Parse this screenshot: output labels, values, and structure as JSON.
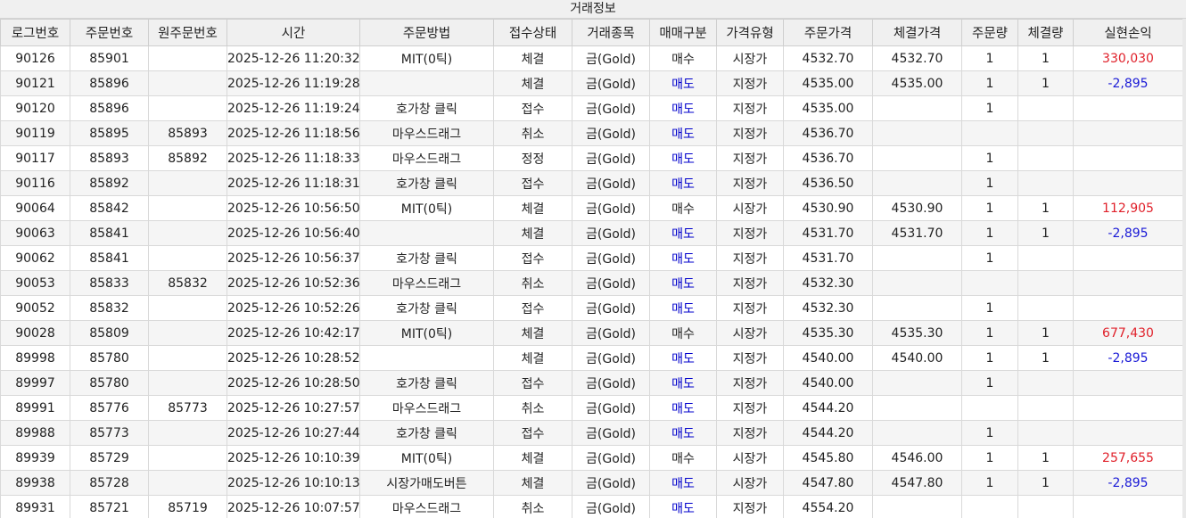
{
  "window": {
    "title": "거래정보"
  },
  "columns": [
    "로그번호",
    "주문번호",
    "원주문번호",
    "시간",
    "주문방법",
    "접수상태",
    "거래종목",
    "매매구분",
    "가격유형",
    "주문가격",
    "체결가격",
    "주문량",
    "체결량",
    "실현손익"
  ],
  "colors": {
    "sell": "#0000cc",
    "pnl_positive": "#e0202a",
    "pnl_negative": "#1a1ad6"
  },
  "rows": [
    {
      "log": "90126",
      "order": "85901",
      "orig": "",
      "time": "2025-12-26 11:20:32",
      "method": "MIT(0틱)",
      "status": "체결",
      "item": "금(Gold)",
      "side": "매수",
      "ptype": "시장가",
      "oprice": "4532.70",
      "fprice": "4532.70",
      "oqty": "1",
      "fqty": "1",
      "pnl": "330,030"
    },
    {
      "log": "90121",
      "order": "85896",
      "orig": "",
      "time": "2025-12-26 11:19:28",
      "method": "",
      "status": "체결",
      "item": "금(Gold)",
      "side": "매도",
      "ptype": "지정가",
      "oprice": "4535.00",
      "fprice": "4535.00",
      "oqty": "1",
      "fqty": "1",
      "pnl": "-2,895"
    },
    {
      "log": "90120",
      "order": "85896",
      "orig": "",
      "time": "2025-12-26 11:19:24",
      "method": "호가창 클릭",
      "status": "접수",
      "item": "금(Gold)",
      "side": "매도",
      "ptype": "지정가",
      "oprice": "4535.00",
      "fprice": "",
      "oqty": "1",
      "fqty": "",
      "pnl": ""
    },
    {
      "log": "90119",
      "order": "85895",
      "orig": "85893",
      "time": "2025-12-26 11:18:56",
      "method": "마우스드래그",
      "status": "취소",
      "item": "금(Gold)",
      "side": "매도",
      "ptype": "지정가",
      "oprice": "4536.70",
      "fprice": "",
      "oqty": "",
      "fqty": "",
      "pnl": ""
    },
    {
      "log": "90117",
      "order": "85893",
      "orig": "85892",
      "time": "2025-12-26 11:18:33",
      "method": "마우스드래그",
      "status": "정정",
      "item": "금(Gold)",
      "side": "매도",
      "ptype": "지정가",
      "oprice": "4536.70",
      "fprice": "",
      "oqty": "1",
      "fqty": "",
      "pnl": ""
    },
    {
      "log": "90116",
      "order": "85892",
      "orig": "",
      "time": "2025-12-26 11:18:31",
      "method": "호가창 클릭",
      "status": "접수",
      "item": "금(Gold)",
      "side": "매도",
      "ptype": "지정가",
      "oprice": "4536.50",
      "fprice": "",
      "oqty": "1",
      "fqty": "",
      "pnl": ""
    },
    {
      "log": "90064",
      "order": "85842",
      "orig": "",
      "time": "2025-12-26 10:56:50",
      "method": "MIT(0틱)",
      "status": "체결",
      "item": "금(Gold)",
      "side": "매수",
      "ptype": "시장가",
      "oprice": "4530.90",
      "fprice": "4530.90",
      "oqty": "1",
      "fqty": "1",
      "pnl": "112,905"
    },
    {
      "log": "90063",
      "order": "85841",
      "orig": "",
      "time": "2025-12-26 10:56:40",
      "method": "",
      "status": "체결",
      "item": "금(Gold)",
      "side": "매도",
      "ptype": "지정가",
      "oprice": "4531.70",
      "fprice": "4531.70",
      "oqty": "1",
      "fqty": "1",
      "pnl": "-2,895"
    },
    {
      "log": "90062",
      "order": "85841",
      "orig": "",
      "time": "2025-12-26 10:56:37",
      "method": "호가창 클릭",
      "status": "접수",
      "item": "금(Gold)",
      "side": "매도",
      "ptype": "지정가",
      "oprice": "4531.70",
      "fprice": "",
      "oqty": "1",
      "fqty": "",
      "pnl": ""
    },
    {
      "log": "90053",
      "order": "85833",
      "orig": "85832",
      "time": "2025-12-26 10:52:36",
      "method": "마우스드래그",
      "status": "취소",
      "item": "금(Gold)",
      "side": "매도",
      "ptype": "지정가",
      "oprice": "4532.30",
      "fprice": "",
      "oqty": "",
      "fqty": "",
      "pnl": ""
    },
    {
      "log": "90052",
      "order": "85832",
      "orig": "",
      "time": "2025-12-26 10:52:26",
      "method": "호가창 클릭",
      "status": "접수",
      "item": "금(Gold)",
      "side": "매도",
      "ptype": "지정가",
      "oprice": "4532.30",
      "fprice": "",
      "oqty": "1",
      "fqty": "",
      "pnl": ""
    },
    {
      "log": "90028",
      "order": "85809",
      "orig": "",
      "time": "2025-12-26 10:42:17",
      "method": "MIT(0틱)",
      "status": "체결",
      "item": "금(Gold)",
      "side": "매수",
      "ptype": "시장가",
      "oprice": "4535.30",
      "fprice": "4535.30",
      "oqty": "1",
      "fqty": "1",
      "pnl": "677,430"
    },
    {
      "log": "89998",
      "order": "85780",
      "orig": "",
      "time": "2025-12-26 10:28:52",
      "method": "",
      "status": "체결",
      "item": "금(Gold)",
      "side": "매도",
      "ptype": "지정가",
      "oprice": "4540.00",
      "fprice": "4540.00",
      "oqty": "1",
      "fqty": "1",
      "pnl": "-2,895"
    },
    {
      "log": "89997",
      "order": "85780",
      "orig": "",
      "time": "2025-12-26 10:28:50",
      "method": "호가창 클릭",
      "status": "접수",
      "item": "금(Gold)",
      "side": "매도",
      "ptype": "지정가",
      "oprice": "4540.00",
      "fprice": "",
      "oqty": "1",
      "fqty": "",
      "pnl": ""
    },
    {
      "log": "89991",
      "order": "85776",
      "orig": "85773",
      "time": "2025-12-26 10:27:57",
      "method": "마우스드래그",
      "status": "취소",
      "item": "금(Gold)",
      "side": "매도",
      "ptype": "지정가",
      "oprice": "4544.20",
      "fprice": "",
      "oqty": "",
      "fqty": "",
      "pnl": ""
    },
    {
      "log": "89988",
      "order": "85773",
      "orig": "",
      "time": "2025-12-26 10:27:44",
      "method": "호가창 클릭",
      "status": "접수",
      "item": "금(Gold)",
      "side": "매도",
      "ptype": "지정가",
      "oprice": "4544.20",
      "fprice": "",
      "oqty": "1",
      "fqty": "",
      "pnl": ""
    },
    {
      "log": "89939",
      "order": "85729",
      "orig": "",
      "time": "2025-12-26 10:10:39",
      "method": "MIT(0틱)",
      "status": "체결",
      "item": "금(Gold)",
      "side": "매수",
      "ptype": "시장가",
      "oprice": "4545.80",
      "fprice": "4546.00",
      "oqty": "1",
      "fqty": "1",
      "pnl": "257,655"
    },
    {
      "log": "89938",
      "order": "85728",
      "orig": "",
      "time": "2025-12-26 10:10:13",
      "method": "시장가매도버튼",
      "status": "체결",
      "item": "금(Gold)",
      "side": "매도",
      "ptype": "시장가",
      "oprice": "4547.80",
      "fprice": "4547.80",
      "oqty": "1",
      "fqty": "1",
      "pnl": "-2,895"
    },
    {
      "log": "89931",
      "order": "85721",
      "orig": "85719",
      "time": "2025-12-26 10:07:57",
      "method": "마우스드래그",
      "status": "취소",
      "item": "금(Gold)",
      "side": "매도",
      "ptype": "지정가",
      "oprice": "4554.20",
      "fprice": "",
      "oqty": "",
      "fqty": "",
      "pnl": ""
    }
  ]
}
